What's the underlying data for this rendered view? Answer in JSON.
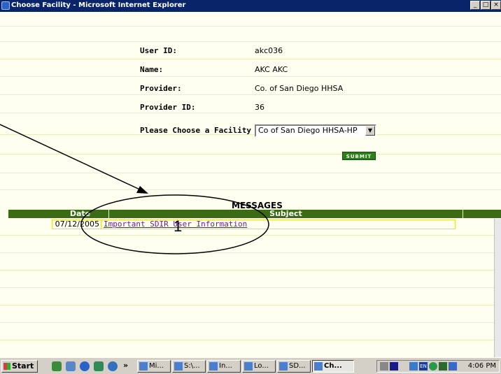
{
  "window": {
    "title": "Choose Facility - Microsoft Internet Explorer",
    "btn_min": "_",
    "btn_max": "□",
    "btn_close": "×"
  },
  "form": {
    "user_id_label": "User ID:",
    "user_id_value": "akc036",
    "name_label": "Name:",
    "name_value": "AKC AKC",
    "provider_label": "Provider:",
    "provider_value": "Co. of San Diego HHSA",
    "provider_id_label": "Provider ID:",
    "provider_id_value": "36",
    "facility_label": "Please Choose a Facility",
    "facility_selected": "Co of San Diego HHSA-HP",
    "submit_label": "SUBMIT"
  },
  "messages": {
    "title": "MESSAGES",
    "col_date": "Date",
    "col_subject": "Subject",
    "rows": [
      {
        "date": "07/12/2005",
        "subject": "Important SDIR User Information"
      }
    ]
  },
  "annotation": {
    "number": "1"
  },
  "taskbar": {
    "start_label": "Start",
    "chevron": "»",
    "tasks": [
      "Mi...",
      "S:\\...",
      "In...",
      "Lo...",
      "SD...",
      "Ch..."
    ],
    "lang": "EN",
    "clock": "4:06 PM"
  },
  "colors": {
    "title_bar": "#0a246a",
    "header_green": "#3b6b14",
    "submit_green": "#2e7d1e",
    "page_bg": "#fffff0",
    "link": "#6a1b9a"
  },
  "icons": [
    "ie-icon",
    "windows-flag-icon",
    "dropdown-arrow-icon",
    "speaker-icon",
    "network-icon"
  ]
}
